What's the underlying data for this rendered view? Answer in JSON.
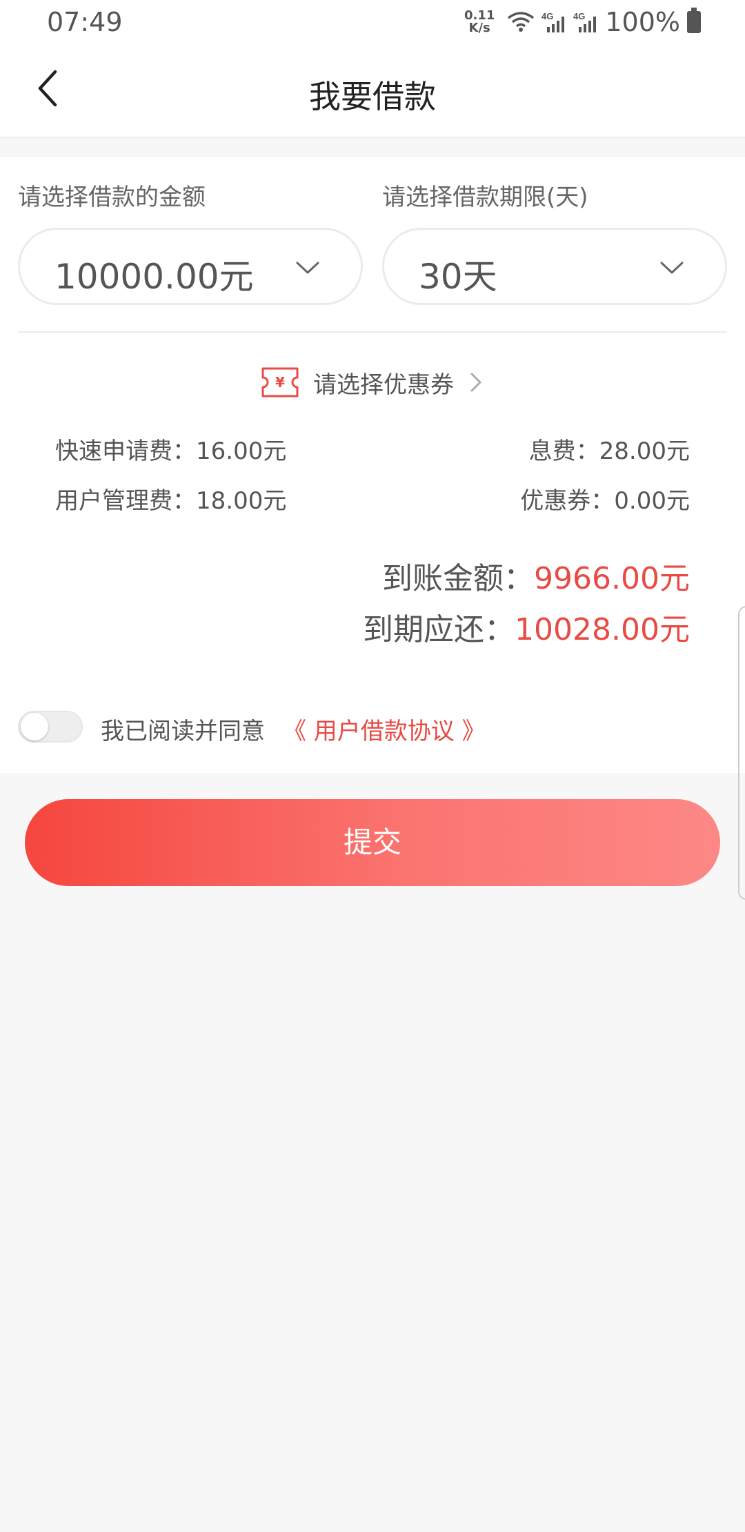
{
  "status_bar": {
    "time": "07:49",
    "net_speed_value": "0.11",
    "net_speed_unit": "K/s",
    "network_badges": [
      "4G",
      "4G"
    ],
    "battery": "100%"
  },
  "nav": {
    "title": "我要借款",
    "back_icon": "chevron-left-icon"
  },
  "form": {
    "amount_label": "请选择借款的金额",
    "amount_value": "10000.00元",
    "term_label": "请选择借款期限(天)",
    "term_value": "30天"
  },
  "coupon": {
    "label": "请选择优惠券",
    "icon": "coupon-icon"
  },
  "fees": {
    "quick_apply_fee": "快速申请费：16.00元",
    "interest_fee": "息费：28.00元",
    "user_management_fee": "用户管理费：18.00元",
    "coupon_discount": "优惠券：0.00元"
  },
  "totals": {
    "received_label": "到账金额：",
    "received_value": "9966.00元",
    "due_label": "到期应还：",
    "due_value": "10028.00元"
  },
  "agreement": {
    "checked": false,
    "text": "我已阅读并同意",
    "link": "《 用户借款协议 》"
  },
  "submit_label": "提交",
  "colors": {
    "accent": "#e84a44",
    "button_gradient_start": "#f5463f",
    "button_gradient_end": "#fc8886",
    "background": "#f7f7f7"
  }
}
